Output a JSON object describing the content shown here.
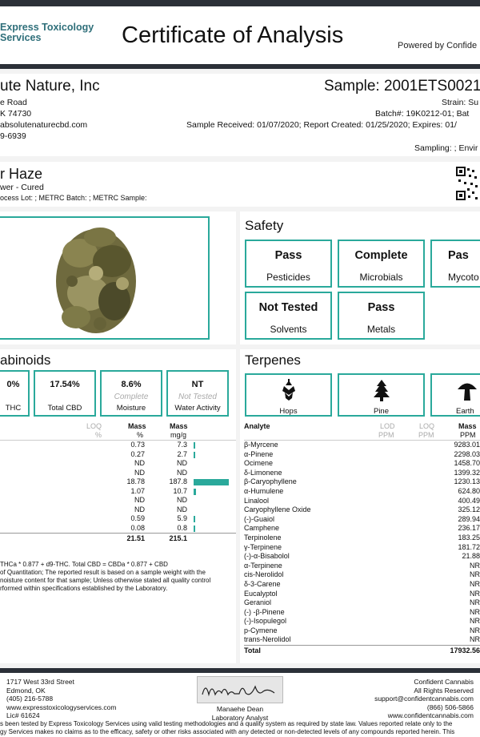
{
  "header": {
    "lab_name_line1": "Express Toxicology",
    "lab_name_line2": "Services",
    "title": "Certificate of Analysis",
    "powered_by": "Powered by Confide"
  },
  "client": {
    "name": "ute Nature, Inc",
    "address1": "e Road",
    "address2": "K 74730",
    "email": "absolutenaturecbd.com",
    "phone": "9-6939"
  },
  "sample": {
    "id": "Sample: 2001ETS0021.",
    "strain": "Strain: Su",
    "batch": "Batch#: 19K0212-01; Bat",
    "dates": "Sample Received: 01/07/2020; Report Created: 01/25/2020; Expires: 01/",
    "sampling": "Sampling: ; Envir"
  },
  "product": {
    "name": "r Haze",
    "type": "wer - Cured",
    "lots": "ocess Lot: ; METRC Batch: ; METRC Sample:"
  },
  "safety": {
    "title": "Safety",
    "cards": [
      {
        "status": "Pass",
        "label": "Pesticides"
      },
      {
        "status": "Complete",
        "label": "Microbials"
      },
      {
        "status": "Pas",
        "label": "Mycoto"
      },
      {
        "status": "Not Tested",
        "label": "Solvents"
      },
      {
        "status": "Pass",
        "label": "Metals"
      }
    ]
  },
  "cannabinoids": {
    "title": "abinoids",
    "cards": [
      {
        "value": "0%",
        "sub": "",
        "label": "THC"
      },
      {
        "value": "17.54%",
        "sub": "",
        "label": "Total CBD"
      },
      {
        "value": "8.6%",
        "sub": "Complete",
        "label": "Moisture"
      },
      {
        "value": "NT",
        "sub": "Not Tested",
        "label": "Water Activity"
      }
    ],
    "headers": {
      "loq": "LOQ",
      "mass1": "Mass",
      "mass2": "Mass",
      "loq_unit": "%",
      "unit1": "%",
      "unit2": "mg/g"
    },
    "rows": [
      {
        "pct": "0.73",
        "mg": "7.3",
        "bar": 0.039
      },
      {
        "pct": "0.27",
        "mg": "2.7",
        "bar": 0.014
      },
      {
        "pct": "ND",
        "mg": "ND",
        "bar": 0
      },
      {
        "pct": "ND",
        "mg": "ND",
        "bar": 0
      },
      {
        "pct": "18.78",
        "mg": "187.8",
        "bar": 1.0
      },
      {
        "pct": "1.07",
        "mg": "10.7",
        "bar": 0.057
      },
      {
        "pct": "ND",
        "mg": "ND",
        "bar": 0
      },
      {
        "pct": "ND",
        "mg": "ND",
        "bar": 0
      },
      {
        "pct": "0.59",
        "mg": "5.9",
        "bar": 0.031
      },
      {
        "pct": "0.08",
        "mg": "0.8",
        "bar": 0.004
      }
    ],
    "total_pct": "21.51",
    "total_mg": "215.1",
    "note1": "THCa * 0.877 + d9-THC. Total CBD = CBDa * 0.877 + CBD",
    "note2": "of Quantitation; The reported result is based on a sample weight with the",
    "note3": "noisture content for that sample; Unless otherwise stated all quality control",
    "note4": "rformed within specifications established by the Laboratory."
  },
  "terpenes": {
    "title": "Terpenes",
    "icons": [
      {
        "label": "Hops",
        "icon": "hops-icon"
      },
      {
        "label": "Pine",
        "icon": "pine-tree-icon"
      },
      {
        "label": "Earth",
        "icon": "mushroom-icon"
      }
    ],
    "headers": {
      "analyte": "Analyte",
      "lod": "LOD",
      "loq": "LOQ",
      "mass": "Mass",
      "lod_unit": "PPM",
      "loq_unit": "PPM",
      "mass_unit": "PPM"
    },
    "rows": [
      {
        "name": "β-Myrcene",
        "mass": "9283.01"
      },
      {
        "name": "α-Pinene",
        "mass": "2298.03"
      },
      {
        "name": "Ocimene",
        "mass": "1458.70"
      },
      {
        "name": "δ-Limonene",
        "mass": "1399.32"
      },
      {
        "name": "β-Caryophyllene",
        "mass": "1230.13"
      },
      {
        "name": "α-Humulene",
        "mass": "624.80"
      },
      {
        "name": "Linalool",
        "mass": "400.49"
      },
      {
        "name": "Caryophyllene Oxide",
        "mass": "325.12"
      },
      {
        "name": "(-)-Guaiol",
        "mass": "289.94"
      },
      {
        "name": "Camphene",
        "mass": "236.17"
      },
      {
        "name": "Terpinolene",
        "mass": "183.25"
      },
      {
        "name": "γ-Terpinene",
        "mass": "181.72"
      },
      {
        "name": "(-)-α-Bisabolol",
        "mass": "21.88"
      },
      {
        "name": "α-Terpinene",
        "mass": "NR"
      },
      {
        "name": "cis-Nerolidol",
        "mass": "NR"
      },
      {
        "name": "δ-3-Carene",
        "mass": "NR"
      },
      {
        "name": "Eucalyptol",
        "mass": "NR"
      },
      {
        "name": "Geraniol",
        "mass": "NR"
      },
      {
        "name": "(-) -β-Pinene",
        "mass": "NR"
      },
      {
        "name": "(-)-Isopulegol",
        "mass": "NR"
      },
      {
        "name": "p-Cymene",
        "mass": "NR"
      },
      {
        "name": "trans-Nerolidol",
        "mass": "NR"
      }
    ],
    "total_label": "Total",
    "total_mass": "17932.56"
  },
  "footer": {
    "addr1": "1717 West 33rd Street",
    "addr2": "Edmond, OK",
    "phone": "(405) 216-5788",
    "web": "www.expresstoxicologyservices.com",
    "lic": "Lic# 61624",
    "signer_name": "Manaehe Dean",
    "signer_title": "Laboratory Analyst",
    "signature": "Manaehe Dean",
    "right1": "Confident Cannabis",
    "right2": "All Rights Reserved",
    "right3": "support@confidentcannabis.com",
    "right4": "(866) 506-5866",
    "right5": "www.confidentcannabis.com",
    "disclaimer1": "s been tested by Express Toxicology Services using valid testing methodologies and a quality system as required by state law. Values reported relate only to the",
    "disclaimer2": "gy Services makes no claims as to the efficacy, safety or other risks associated with any detected or non-detected levels of any compounds reported herein. This"
  }
}
